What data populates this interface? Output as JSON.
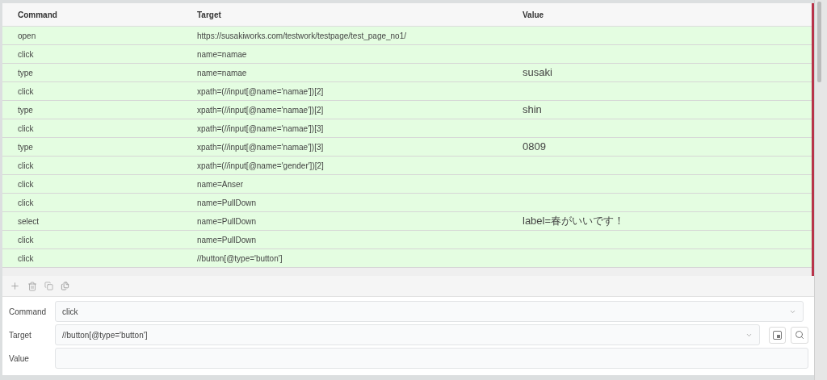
{
  "table": {
    "columns": [
      "Command",
      "Target",
      "Value"
    ],
    "rows": [
      {
        "command": "open",
        "target": "https://susakiworks.com/testwork/testpage/test_page_no1/",
        "passed": true
      },
      {
        "command": "click",
        "target": "name=namae",
        "passed": true
      },
      {
        "command": "type",
        "target": "name=namae",
        "value": "susaki",
        "passed": true
      },
      {
        "command": "click",
        "target": "xpath=(//input[@name='namae'])[2]",
        "passed": true
      },
      {
        "command": "type",
        "target": "xpath=(//input[@name='namae'])[2]",
        "value": "shin",
        "passed": true
      },
      {
        "command": "click",
        "target": "xpath=(//input[@name='namae'])[3]",
        "passed": true
      },
      {
        "command": "type",
        "target": "xpath=(//input[@name='namae'])[3]",
        "value": "0809",
        "passed": true
      },
      {
        "command": "click",
        "target": "xpath=(//input[@name='gender'])[2]",
        "passed": true
      },
      {
        "command": "click",
        "target": "name=Anser",
        "passed": true
      },
      {
        "command": "click",
        "target": "name=PullDown",
        "passed": true
      },
      {
        "command": "select",
        "target": "name=PullDown",
        "value": "label=春がいいです！",
        "passed": true
      },
      {
        "command": "click",
        "target": "name=PullDown",
        "passed": true
      },
      {
        "command": "click",
        "target": "//button[@type='button']",
        "passed": true
      }
    ]
  },
  "editor": {
    "command": {
      "label": "Command",
      "value": "click"
    },
    "target": {
      "label": "Target",
      "value": "//button[@type='button']"
    },
    "value": {
      "label": "Value"
    }
  }
}
